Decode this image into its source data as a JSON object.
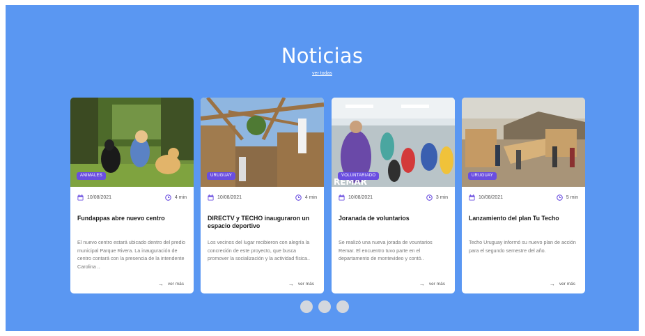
{
  "section": {
    "title": "Noticias",
    "see_all": "ver todas"
  },
  "cards": [
    {
      "tag": "ANIMALES",
      "date": "10/08/2021",
      "read_time": "4 min",
      "title": "Fundappas abre nuevo centro",
      "body": "El nuevo centro estará ubicado dentro del predio municipal Parque Rivera. La inauguración de centro contará con la presencia de la intendente Carolina ..",
      "more": "ver más"
    },
    {
      "tag": "URUGUAY",
      "date": "10/08/2021",
      "read_time": "4 min",
      "title": "DIRECTV y TECHO inauguraron un espacio deportivo",
      "body": "Los vecinos del lugar recibieron con alegría la concreción de este proyecto, que busca promover la socialización y la actividad física..",
      "more": "ver más"
    },
    {
      "tag": "VOLUNTARIADO",
      "date": "10/08/2021",
      "read_time": "3 min",
      "title": "Joranada de voluntarios",
      "body": "Se realizó una nueva jorada de vountarios Remar. El encuentro tuvo parte en el departamento de montevideo y contó..",
      "more": "ver más",
      "photo_text": "REMAR"
    },
    {
      "tag": "URUGUAY",
      "date": "10/08/2021",
      "read_time": "5 min",
      "title": "Lanzamiento del plan Tu Techo",
      "body": "Techo Uruguay informó su nuevo plan de acción para el segundo semestre del año.",
      "more": "ver más"
    }
  ],
  "carousel": {
    "dots": 3
  },
  "colors": {
    "background": "#5a97f2",
    "tag": "#6a4ee0",
    "card": "#ffffff",
    "dot": "#d3d7de"
  }
}
